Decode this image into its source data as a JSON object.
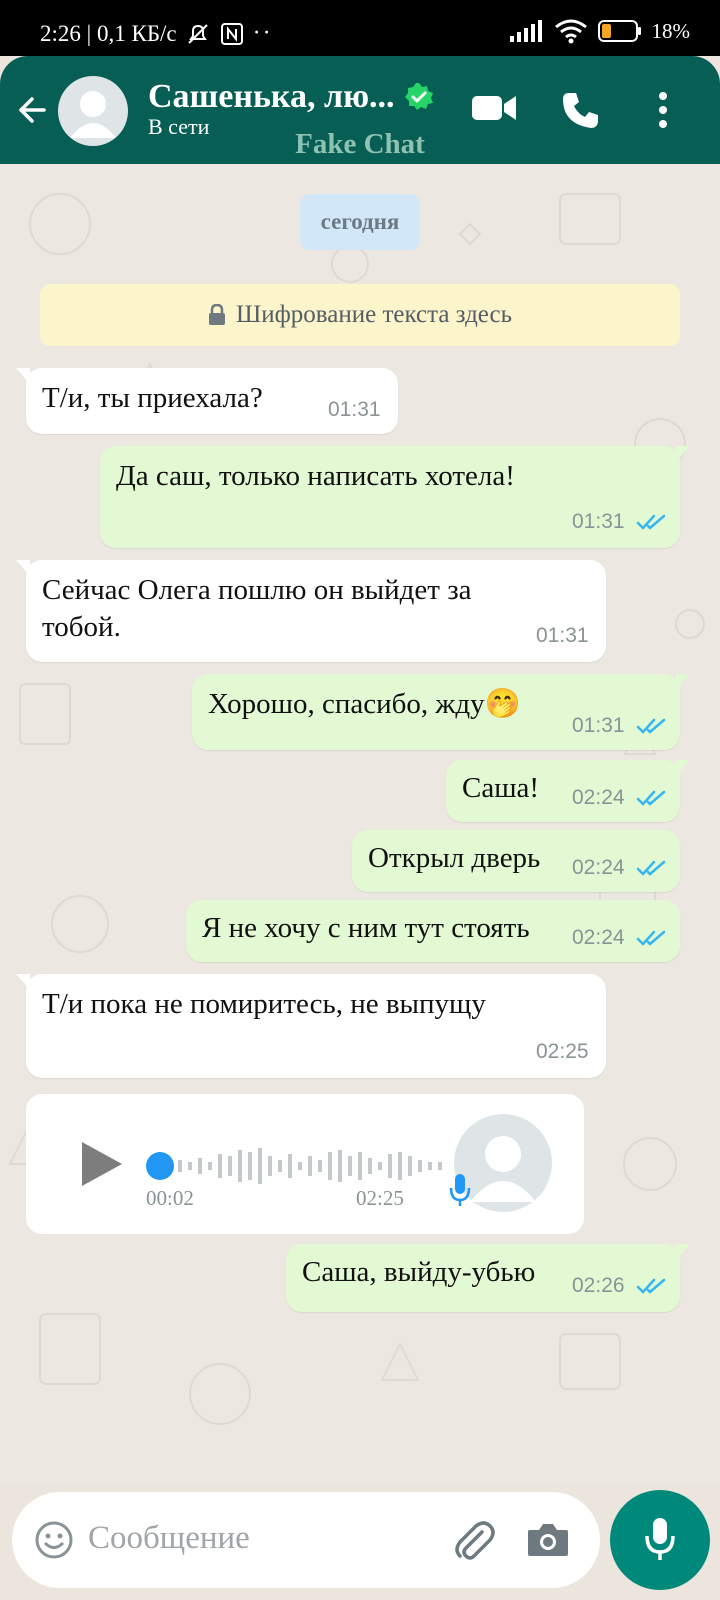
{
  "status_bar": {
    "time_info": "2:26 | 0,1 КБ/с",
    "battery": "18%"
  },
  "header": {
    "contact_name": "Сашенька, лю...",
    "status": "В сети",
    "watermark": "Fake Chat"
  },
  "chat": {
    "date_label": "сегодня",
    "encryption_notice": "Шифрование текста здесь",
    "messages": [
      {
        "direction": "in",
        "text": "Т/и, ты приехала?",
        "time": "01:31"
      },
      {
        "direction": "out",
        "text": "Да саш, только написать хотела!",
        "time": "01:31"
      },
      {
        "direction": "in",
        "text": "Сейчас Олега пошлю он выйдет за тобой.",
        "time": "01:31"
      },
      {
        "direction": "out",
        "text": "Хорошо, спасибо, жду",
        "emoji": "🤭",
        "time": "01:31"
      },
      {
        "direction": "out",
        "text": "Саша!",
        "time": "02:24"
      },
      {
        "direction": "out",
        "text": "Открыл дверь",
        "time": "02:24"
      },
      {
        "direction": "out",
        "text": "Я не хочу с ним тут стоять",
        "time": "02:24"
      },
      {
        "direction": "in",
        "text": "Т/и пока не помиритесь, не выпущу",
        "time": "02:25"
      },
      {
        "direction": "out",
        "text": "Саша, выйду-убью",
        "time": "02:26"
      }
    ],
    "voice_message": {
      "duration": "00:02",
      "time": "02:25"
    }
  },
  "input": {
    "placeholder": "Сообщение"
  },
  "colors": {
    "header": "#075e54",
    "outgoing_bubble": "#e2f9d4",
    "incoming_bubble": "#ffffff",
    "read_ticks": "#34b7f1",
    "mic_button": "#00897b"
  },
  "icons": [
    "back-arrow-icon",
    "verified-icon",
    "video-call-icon",
    "phone-icon",
    "more-icon",
    "lock-icon",
    "play-icon",
    "mic-icon",
    "emoji-icon",
    "attach-icon",
    "camera-icon"
  ]
}
